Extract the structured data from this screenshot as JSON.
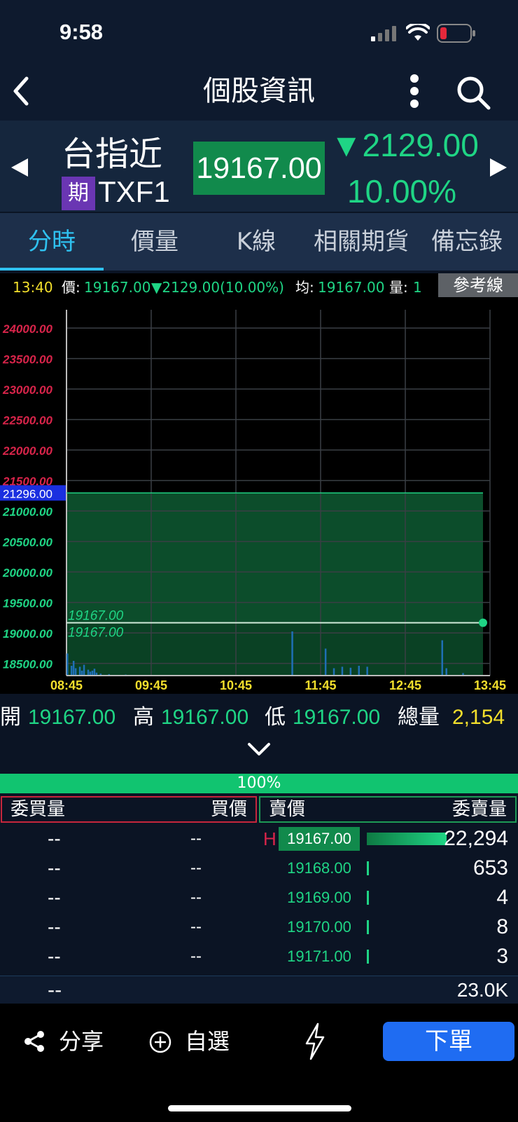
{
  "status": {
    "time": "9:58"
  },
  "nav": {
    "title": "個股資訊"
  },
  "quote": {
    "name": "台指近",
    "badge": "期",
    "code": "TXF1",
    "price": "19167.00",
    "change": "▼2129.00",
    "change_pct": "10.00%"
  },
  "tabs": [
    "分時",
    "價量",
    "K線",
    "相關期貨",
    "備忘錄"
  ],
  "info": {
    "time": "13:40",
    "price_label": "價:",
    "price": "19167.00",
    "change": "▼2129.00(10.00%)",
    "avg_label": "均:",
    "avg": "19167.00",
    "vol_label": "量:",
    "vol": "1",
    "ref_button": "參考線"
  },
  "chart_data": {
    "type": "area",
    "x_ticks": [
      "08:45",
      "09:45",
      "10:45",
      "11:45",
      "12:45",
      "13:45"
    ],
    "y_ticks": [
      "24000.00",
      "23500.00",
      "23000.00",
      "22500.00",
      "22000.00",
      "21500.00",
      "21000.00",
      "20500.00",
      "20000.00",
      "19500.00",
      "19000.00",
      "18500.00"
    ],
    "ylim": [
      18300,
      24300
    ],
    "reference": {
      "label": "21296.00",
      "value": 21296
    },
    "price_line": {
      "value": 19167,
      "label": "19167.00"
    },
    "low_label": "19167.00",
    "volume_bars": [
      {
        "t": 0.0,
        "v": 0.45
      },
      {
        "t": 0.01,
        "v": 0.2
      },
      {
        "t": 0.015,
        "v": 0.3
      },
      {
        "t": 0.02,
        "v": 0.15
      },
      {
        "t": 0.03,
        "v": 0.18
      },
      {
        "t": 0.035,
        "v": 0.1
      },
      {
        "t": 0.04,
        "v": 0.22
      },
      {
        "t": 0.05,
        "v": 0.12
      },
      {
        "t": 0.055,
        "v": 0.08
      },
      {
        "t": 0.06,
        "v": 0.1
      },
      {
        "t": 0.065,
        "v": 0.14
      },
      {
        "t": 0.07,
        "v": 0.06
      },
      {
        "t": 0.08,
        "v": 0.04
      },
      {
        "t": 0.1,
        "v": 0.03
      },
      {
        "t": 0.14,
        "v": 0.02
      },
      {
        "t": 0.54,
        "v": 0.9
      },
      {
        "t": 0.62,
        "v": 0.55
      },
      {
        "t": 0.64,
        "v": 0.15
      },
      {
        "t": 0.66,
        "v": 0.18
      },
      {
        "t": 0.68,
        "v": 0.16
      },
      {
        "t": 0.7,
        "v": 0.2
      },
      {
        "t": 0.72,
        "v": 0.18
      },
      {
        "t": 0.9,
        "v": 0.72
      },
      {
        "t": 0.91,
        "v": 0.15
      },
      {
        "t": 0.95,
        "v": 0.05
      }
    ],
    "colors": {
      "up": "#d8244a",
      "down": "#1fd585",
      "area": "#0e5a33",
      "vol": "#1f6fb5",
      "axis_x": "#f3df2c"
    }
  },
  "ohlc": {
    "open_label": "開",
    "open": "19167.00",
    "high_label": "高",
    "high": "19167.00",
    "low_label": "低",
    "low": "19167.00",
    "vol_label": "總量",
    "vol": "2,154"
  },
  "orderbook": {
    "ratio": "100%",
    "bid_vol_header": "委買量",
    "bid_price_header": "買價",
    "ask_price_header": "賣價",
    "ask_vol_header": "委賣量",
    "high_marker": "H",
    "rows": [
      {
        "bid_vol": "--",
        "bid_price": "--",
        "ask_price": "19167.00",
        "ask_vol": "22,294",
        "bar": 1.0
      },
      {
        "bid_vol": "--",
        "bid_price": "--",
        "ask_price": "19168.00",
        "ask_vol": "653",
        "bar": 0.03
      },
      {
        "bid_vol": "--",
        "bid_price": "--",
        "ask_price": "19169.00",
        "ask_vol": "4",
        "bar": 0.02
      },
      {
        "bid_vol": "--",
        "bid_price": "--",
        "ask_price": "19170.00",
        "ask_vol": "8",
        "bar": 0.02
      },
      {
        "bid_vol": "--",
        "bid_price": "--",
        "ask_price": "19171.00",
        "ask_vol": "3",
        "bar": 0.02
      }
    ],
    "bid_total": "--",
    "ask_total": "23.0K"
  },
  "toolbar": {
    "share_label": "分享",
    "watch_label": "自選",
    "order_label": "下單"
  }
}
